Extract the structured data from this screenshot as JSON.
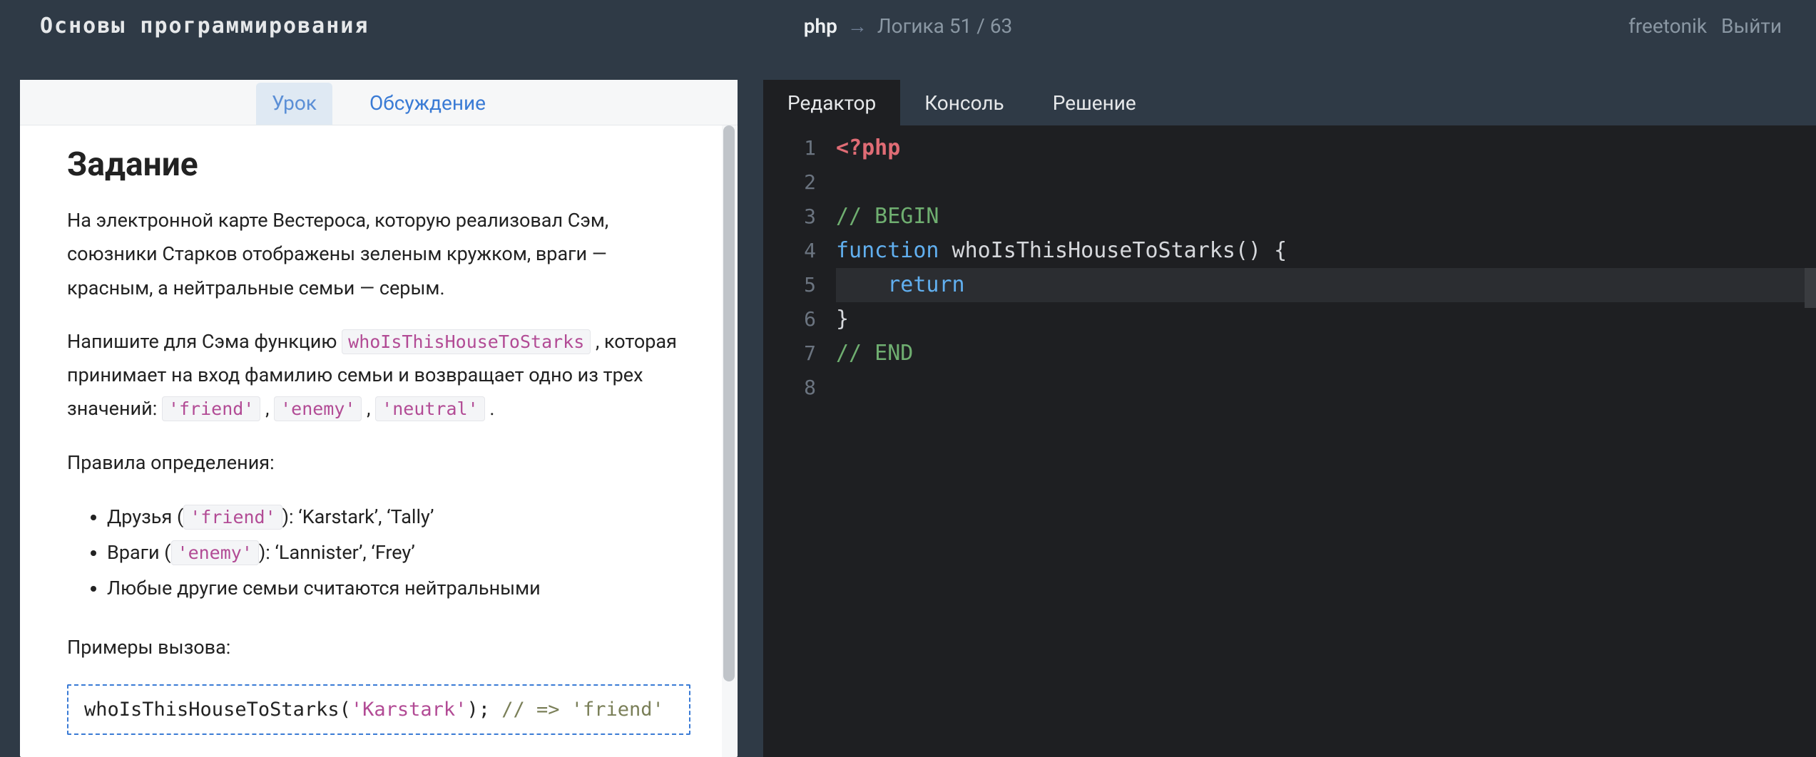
{
  "header": {
    "title": "Основы программирования",
    "breadcrumb": {
      "lang": "php",
      "arrow": "→",
      "section": "Логика",
      "pos": "51",
      "sep": "/",
      "total": "63"
    },
    "user": "freetonik",
    "logout": "Выйти"
  },
  "left": {
    "tabs": {
      "lesson": "Урок",
      "discussion": "Обсуждение"
    },
    "heading": "Задание",
    "p1": "На электронной карте Вестероса, которую реализовал Сэм, союзники Старков отображены зеленым кружком, враги — красным, а нейтральные семьи — серым.",
    "p2a": "Напишите для Сэма функцию ",
    "p2_code": "whoIsThisHouseToStarks",
    "p2b": " , которая принимает на вход фамилию семьи и возвращает одно из трех значений: ",
    "p2_vals": {
      "v1": "'friend'",
      "v2": "'enemy'",
      "v3": "'neutral'"
    },
    "p2_comma": " , ",
    "p2_dot": " .",
    "rules_heading": "Правила определения:",
    "rules": {
      "r1a": "Друзья (",
      "r1c": "'friend'",
      "r1b": "): ‘Karstark’, ‘Tally’",
      "r2a": "Враги (",
      "r2c": "'enemy'",
      "r2b": "): ‘Lannister’, ‘Frey’",
      "r3": "Любые другие семьи считаются нейтральными"
    },
    "examples_heading": "Примеры вызова:",
    "example": {
      "fn_open": "whoIsThisHouseToStarks(",
      "arg": "'Karstark'",
      "fn_close": "); ",
      "comment": "// => 'friend'"
    }
  },
  "right": {
    "tabs": {
      "editor": "Редактор",
      "console": "Консоль",
      "solution": "Решение"
    },
    "lines": {
      "l1": "1",
      "l2": "2",
      "l3": "3",
      "l4": "4",
      "l5": "5",
      "l6": "6",
      "l7": "7",
      "l8": "8"
    },
    "code": {
      "c1": "<?php",
      "c3": "// BEGIN",
      "c4_kw": "function",
      "c4_fn": " whoIsThisHouseToStarks",
      "c4_rest": "() {",
      "c5_indent": "    ",
      "c5_kw": "return",
      "c6": "}",
      "c7": "// END"
    }
  }
}
